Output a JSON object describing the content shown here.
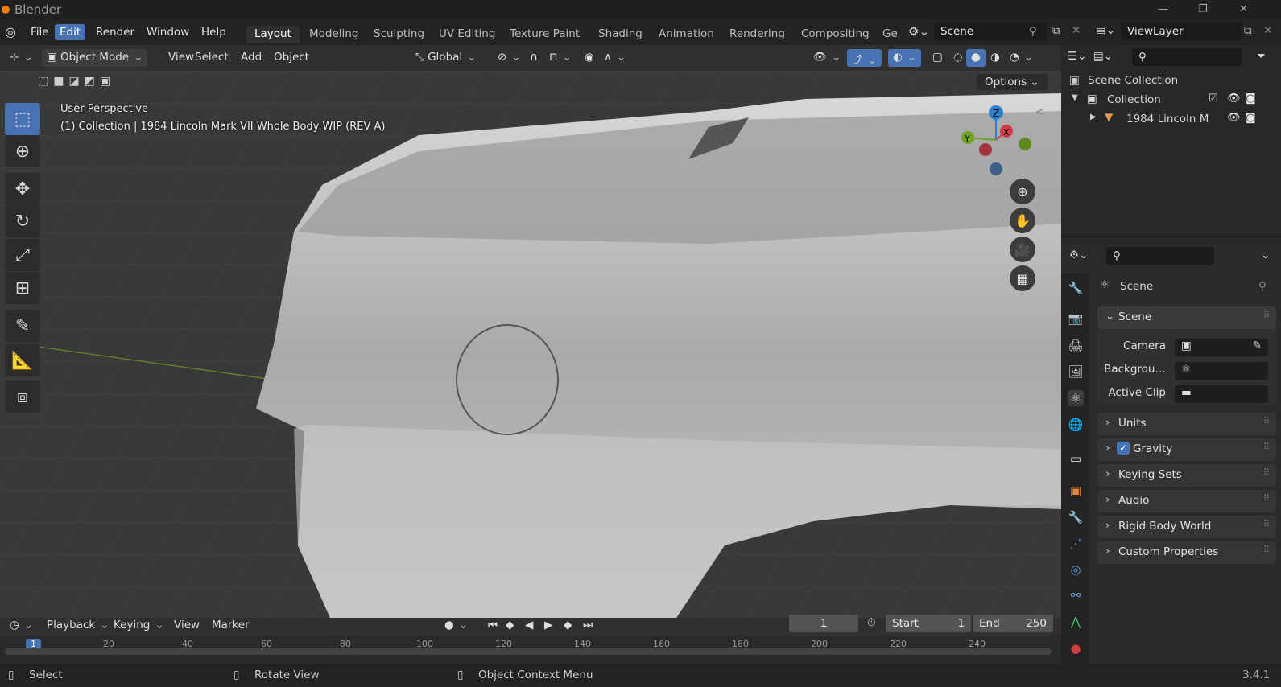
{
  "app": {
    "title": "Blender",
    "version": "3.4.1"
  },
  "menus": [
    "File",
    "Edit",
    "Render",
    "Window",
    "Help"
  ],
  "workspaces": [
    "Layout",
    "Modeling",
    "Sculpting",
    "UV Editing",
    "Texture Paint",
    "Shading",
    "Animation",
    "Rendering",
    "Compositing",
    "Ge"
  ],
  "scene_field": "Scene",
  "viewlayer_field": "ViewLayer",
  "viewport_header": {
    "mode": "Object Mode",
    "menus": [
      "View",
      "Select",
      "Add",
      "Object"
    ],
    "orientation": "Global",
    "options": "Options"
  },
  "viewport": {
    "perspective": "User Perspective",
    "collection_info": "(1) Collection | 1984 Lincoln Mark VII Whole Body WIP (REV A)",
    "gizmo": {
      "z": "Z",
      "y": "Y",
      "x": "X"
    }
  },
  "outliner": {
    "root": "Scene Collection",
    "collection": "Collection",
    "object": "1984 Lincoln M"
  },
  "properties": {
    "context": "Scene",
    "panel_open": "Scene",
    "fields": [
      {
        "label": "Camera"
      },
      {
        "label": "Backgrou…"
      },
      {
        "label": "Active Clip"
      }
    ],
    "panels": [
      "Units",
      "Gravity",
      "Keying Sets",
      "Audio",
      "Rigid Body World",
      "Custom Properties"
    ],
    "gravity_checked": true
  },
  "timeline": {
    "menus": [
      "Playback",
      "Keying",
      "View",
      "Marker"
    ],
    "current_frame": "1",
    "start_label": "Start",
    "start": "1",
    "end_label": "End",
    "end": "250",
    "ticks": [
      "1",
      "20",
      "40",
      "60",
      "80",
      "100",
      "120",
      "140",
      "160",
      "180",
      "200",
      "220",
      "240"
    ]
  },
  "status": {
    "select": "Select",
    "rotate": "Rotate View",
    "context": "Object Context Menu"
  }
}
